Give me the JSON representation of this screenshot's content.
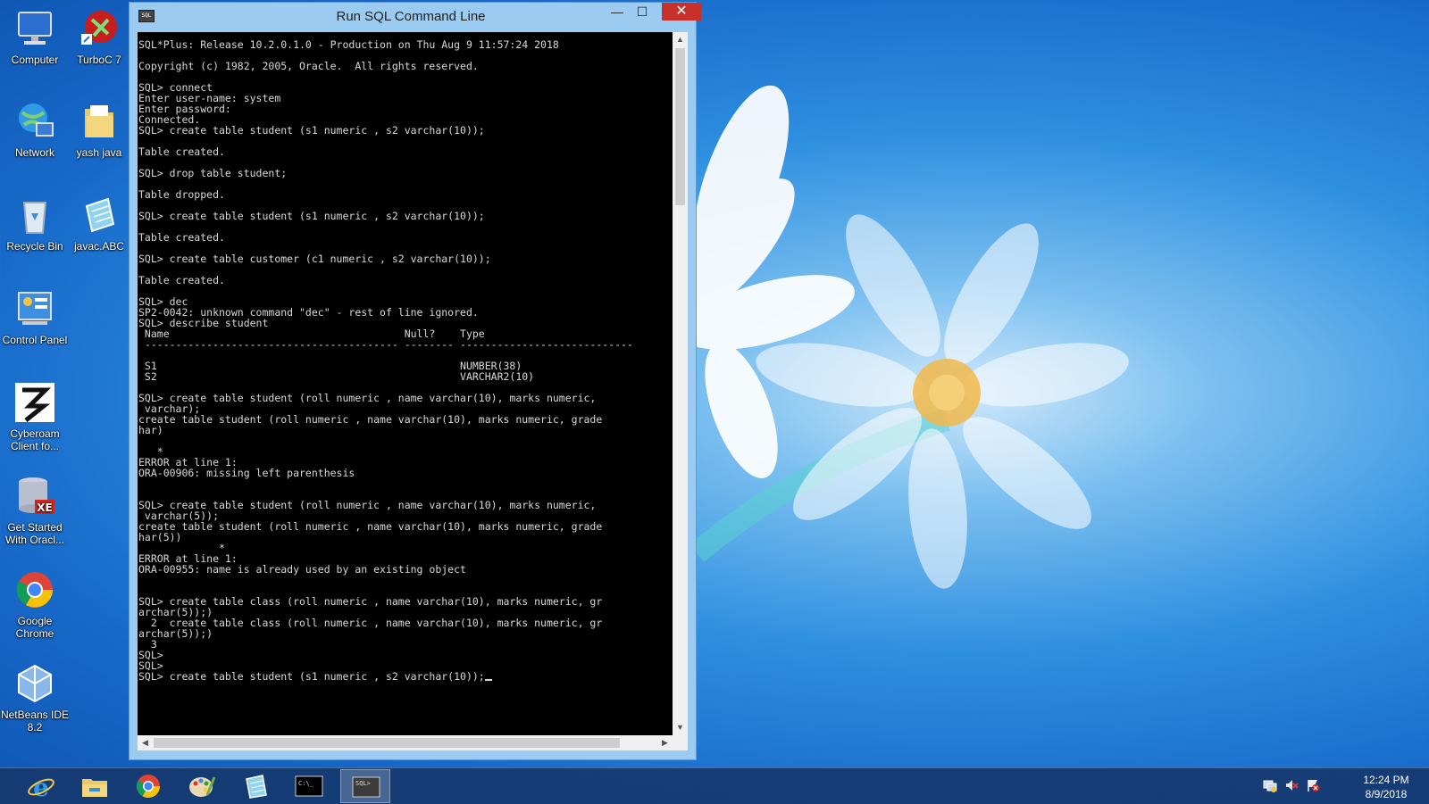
{
  "desktop": {
    "icons": [
      {
        "label": "Computer"
      },
      {
        "label": "TurboC 7"
      },
      {
        "label": "Network"
      },
      {
        "label": "yash java"
      },
      {
        "label": "Recycle Bin"
      },
      {
        "label": "javac.ABC"
      },
      {
        "label": "Control Panel"
      },
      {
        "label": "Cyberoam Client fo..."
      },
      {
        "label": "Get Started With Oracl..."
      },
      {
        "label": "Google Chrome"
      },
      {
        "label": "NetBeans IDE 8.2"
      }
    ]
  },
  "window": {
    "title": "Run SQL Command Line",
    "icon_label": "SQL",
    "minimize_glyph": "—",
    "maximize_glyph": "☐",
    "close_glyph": "✕"
  },
  "console": {
    "lines": [
      "SQL*Plus: Release 10.2.0.1.0 - Production on Thu Aug 9 11:57:24 2018",
      "",
      "Copyright (c) 1982, 2005, Oracle.  All rights reserved.",
      "",
      "SQL> connect",
      "Enter user-name: system",
      "Enter password:",
      "Connected.",
      "SQL> create table student (s1 numeric , s2 varchar(10));",
      "",
      "Table created.",
      "",
      "SQL> drop table student;",
      "",
      "Table dropped.",
      "",
      "SQL> create table student (s1 numeric , s2 varchar(10));",
      "",
      "Table created.",
      "",
      "SQL> create table customer (c1 numeric , s2 varchar(10));",
      "",
      "Table created.",
      "",
      "SQL> dec",
      "SP2-0042: unknown command \"dec\" - rest of line ignored.",
      "SQL> describe student",
      " Name                                      Null?    Type",
      " ----------------------------------------- -------- ----------------------------",
      "",
      " S1                                                 NUMBER(38)",
      " S2                                                 VARCHAR2(10)",
      "",
      "SQL> create table student (roll numeric , name varchar(10), marks numeric,",
      " varchar);",
      "create table student (roll numeric , name varchar(10), marks numeric, grade",
      "har)",
      "",
      "   *",
      "ERROR at line 1:",
      "ORA-00906: missing left parenthesis",
      "",
      "",
      "SQL> create table student (roll numeric , name varchar(10), marks numeric,",
      " varchar(5));",
      "create table student (roll numeric , name varchar(10), marks numeric, grade",
      "har(5))",
      "             *",
      "ERROR at line 1:",
      "ORA-00955: name is already used by an existing object",
      "",
      "",
      "SQL> create table class (roll numeric , name varchar(10), marks numeric, gr",
      "archar(5));)",
      "  2  create table class (roll numeric , name varchar(10), marks numeric, gr",
      "archar(5));)",
      "  3",
      "SQL>",
      "SQL>",
      "SQL> create table student (s1 numeric , s2 varchar(10));"
    ]
  },
  "scrollbars": {
    "up": "▲",
    "down": "▼",
    "left": "◀",
    "right": "▶"
  },
  "taskbar": {
    "apps": [
      "internet-explorer",
      "file-explorer",
      "google-chrome",
      "paint",
      "notepad",
      "command-prompt",
      "sql-command-line"
    ],
    "active": "sql-command-line",
    "cmd_label": "C:\\_",
    "sql_label": "SQL>"
  },
  "clock": {
    "time": "12:24 PM",
    "date": "8/9/2018"
  }
}
